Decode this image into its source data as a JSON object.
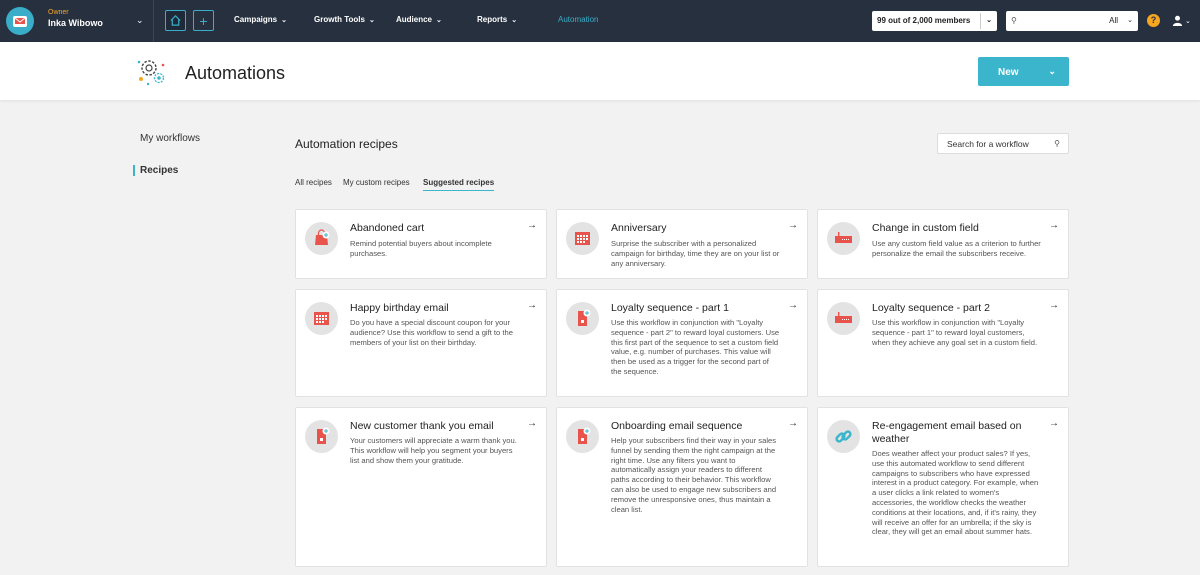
{
  "topnav": {
    "owner_role": "Owner",
    "owner_name": "Inka Wibowo",
    "items": [
      {
        "label": "Campaigns"
      },
      {
        "label": "Growth Tools"
      },
      {
        "label": "Audience"
      },
      {
        "label": "Reports"
      },
      {
        "label": "Automation"
      }
    ],
    "members_label": "99 out of 2,000 members",
    "search_scope": "All",
    "help_label": "?"
  },
  "header": {
    "title": "Automations",
    "new_button": "New"
  },
  "sidebar": {
    "items": [
      {
        "label": "My workflows"
      },
      {
        "label": "Recipes"
      }
    ]
  },
  "main": {
    "section_title": "Automation recipes",
    "search_placeholder": "Search for a workflow",
    "tabs": [
      {
        "label": "All recipes"
      },
      {
        "label": "My custom recipes"
      },
      {
        "label": "Suggested recipes"
      }
    ],
    "cards": [
      {
        "title": "Abandoned cart",
        "desc": "Remind potential buyers about incomplete purchases.",
        "icon": "shopping-bag-icon"
      },
      {
        "title": "Anniversary",
        "desc": "Surprise the subscriber with a personalized campaign for birthday, time they are on your list or any anniversary.",
        "icon": "calendar-icon"
      },
      {
        "title": "Change in custom field",
        "desc": "Use any custom field value as a criterion to further personalize the email the subscribers receive.",
        "icon": "custom-field-icon"
      },
      {
        "title": "Happy birthday email",
        "desc": "Do you have a special discount coupon for your audience? Use this workflow to send a gift to the members of your list on their birthday.",
        "icon": "calendar-icon"
      },
      {
        "title": "Loyalty sequence - part 1",
        "desc": "Use this workflow in conjunction with \"Loyalty sequence - part 2\" to reward loyal customers. Use this first part of the sequence to set a custom field value, e.g. number of purchases. This value will then be used as a trigger for the second part of the sequence.",
        "icon": "loyalty-card-icon"
      },
      {
        "title": "Loyalty sequence - part 2",
        "desc": "Use this workflow in conjunction with \"Loyalty sequence - part 1\" to reward loyal customers, when they achieve any goal set in a custom field.",
        "icon": "custom-field-icon"
      },
      {
        "title": "New customer thank you email",
        "desc": "Your customers will appreciate a warm thank you. This workflow will help you segment your buyers list and show them your gratitude.",
        "icon": "loyalty-card-icon"
      },
      {
        "title": "Onboarding email sequence",
        "desc": "Help your subscribers find their way in your sales funnel by sending them the right campaign at the right time. Use any filters you want to automatically assign your readers to different paths according to their behavior. This workflow can also be used to engage new subscribers and remove the unresponsive ones, thus maintain a clean list.",
        "icon": "loyalty-card-icon"
      },
      {
        "title": "Re-engagement email based on weather",
        "desc": "Does weather affect your product sales? If yes, use this automated workflow to send different campaigns to subscribers who have expressed interest in a product category. For example, when a user clicks a link related to women's accessories, the workflow checks the weather conditions at their locations, and, if it's rainy, they will receive an offer for an umbrella; if the sky is clear, they will get an email about summer hats.",
        "icon": "link-icon"
      }
    ]
  },
  "colors": {
    "nav_bg": "#27303f",
    "accent": "#3ab5cc",
    "icon_red": "#e8544b",
    "owner_role": "#f5a623"
  }
}
